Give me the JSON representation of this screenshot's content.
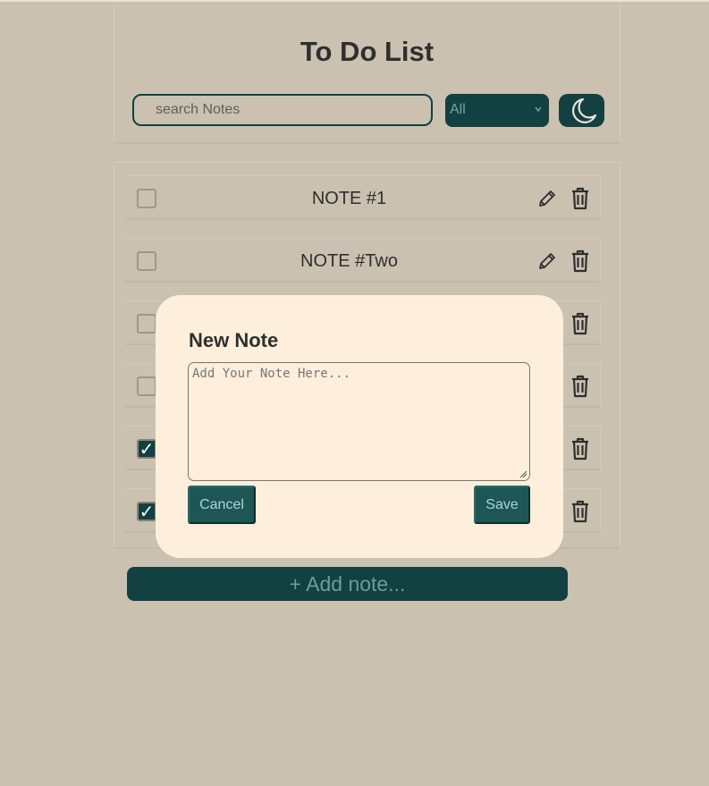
{
  "app": {
    "title": "To Do List"
  },
  "toolbar": {
    "search_placeholder": "search Notes",
    "search_value": "",
    "filter_selected": "All",
    "theme_toggle_icon": "moon-icon"
  },
  "notes": [
    {
      "text": "NOTE #1",
      "checked": false
    },
    {
      "text": "NOTE #Two",
      "checked": false
    },
    {
      "text": "",
      "checked": false
    },
    {
      "text": "",
      "checked": false
    },
    {
      "text": "",
      "checked": true
    },
    {
      "text": "",
      "checked": true
    }
  ],
  "add_note": {
    "label": "+ Add note..."
  },
  "modal": {
    "title": "New Note",
    "textarea_placeholder": "Add Your Note Here...",
    "textarea_value": "",
    "cancel_label": "Cancel",
    "save_label": "Save"
  },
  "colors": {
    "background": "#cbc1b1",
    "accent": "#134040",
    "modal_bg": "#fdefdc",
    "button": "#1e5656"
  },
  "icons": {
    "check_mark": "✓",
    "edit": "pencil-icon",
    "delete": "trash-icon",
    "filter_chevron": "chevron-down-icon"
  }
}
